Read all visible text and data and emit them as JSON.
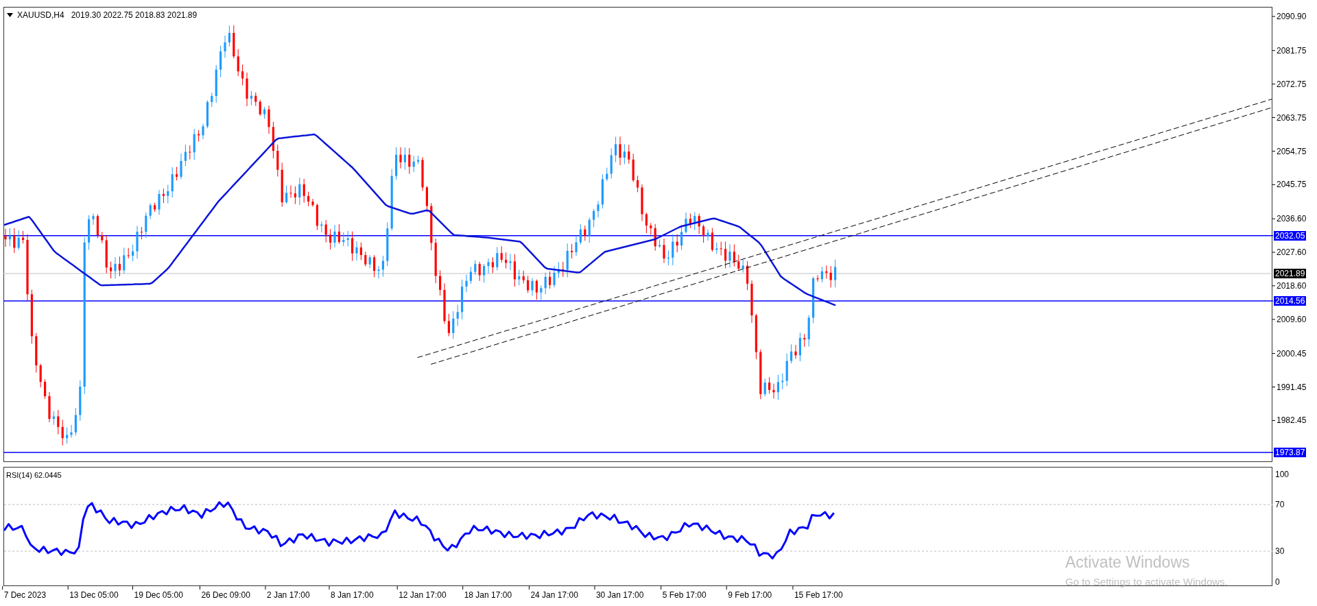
{
  "chart_header": {
    "symbol": "XAUUSD,H4",
    "quote": "2019.30 2022.75 2018.83 2021.89"
  },
  "price_axis": [
    {
      "text": "2090.90",
      "kind": "tick"
    },
    {
      "text": "2081.75",
      "kind": "tick"
    },
    {
      "text": "2072.75",
      "kind": "tick"
    },
    {
      "text": "2063.75",
      "kind": "tick"
    },
    {
      "text": "2054.75",
      "kind": "tick"
    },
    {
      "text": "2045.75",
      "kind": "tick"
    },
    {
      "text": "2036.60",
      "kind": "tick"
    },
    {
      "text": "2032.05",
      "kind": "level"
    },
    {
      "text": "2027.60",
      "kind": "tick"
    },
    {
      "text": "2021.89",
      "kind": "current"
    },
    {
      "text": "2018.60",
      "kind": "tick"
    },
    {
      "text": "2014.56",
      "kind": "level"
    },
    {
      "text": "2009.60",
      "kind": "tick"
    },
    {
      "text": "2000.45",
      "kind": "tick"
    },
    {
      "text": "1991.45",
      "kind": "tick"
    },
    {
      "text": "1982.45",
      "kind": "tick"
    },
    {
      "text": "1973.87",
      "kind": "level"
    }
  ],
  "indicator": {
    "label": "RSI(14) 62.0445",
    "axis": [
      "100",
      "70",
      "30",
      "0"
    ]
  },
  "time_axis": [
    "7 Dec 2023",
    "13 Dec 05:00",
    "19 Dec 05:00",
    "26 Dec 09:00",
    "2 Jan 17:00",
    "8 Jan 17:00",
    "12 Jan 17:00",
    "18 Jan 17:00",
    "24 Jan 17:00",
    "30 Jan 17:00",
    "5 Feb 17:00",
    "9 Feb 17:00",
    "15 Feb 17:00"
  ],
  "activation_notice": {
    "title": "Activate Windows",
    "message": "Go to Settings to activate Windows."
  }
}
